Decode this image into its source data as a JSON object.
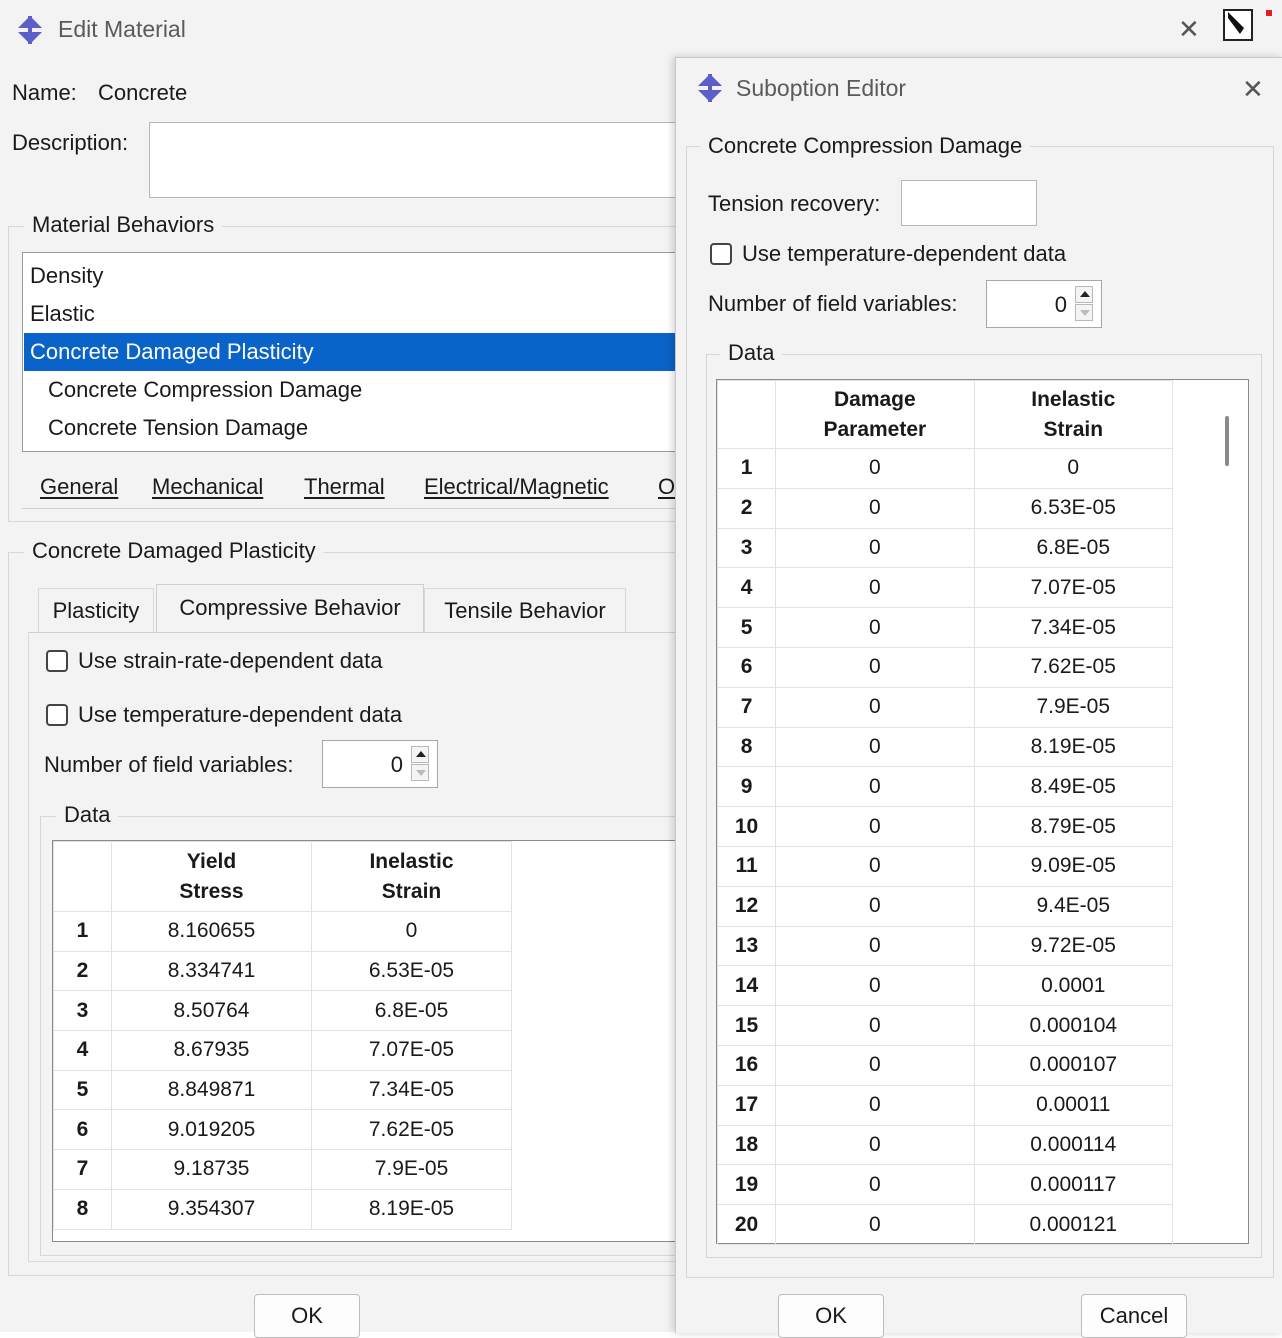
{
  "edit_material": {
    "title": "Edit Material",
    "name_label": "Name:",
    "name_value": "Concrete",
    "description_label": "Description:",
    "description_value": "",
    "material_behaviors": {
      "title": "Material Behaviors",
      "items": [
        {
          "label": "Density",
          "selected": false,
          "sub": false
        },
        {
          "label": "Elastic",
          "selected": false,
          "sub": false
        },
        {
          "label": "Concrete Damaged Plasticity",
          "selected": true,
          "sub": false
        },
        {
          "label": "Concrete Compression Damage",
          "selected": false,
          "sub": true
        },
        {
          "label": "Concrete Tension Damage",
          "selected": false,
          "sub": true
        }
      ]
    },
    "menus": [
      "General",
      "Mechanical",
      "Thermal",
      "Electrical/Magnetic",
      "O"
    ],
    "cdp": {
      "title": "Concrete Damaged Plasticity",
      "tabs": [
        "Plasticity",
        "Compressive Behavior",
        "Tensile Behavior"
      ],
      "active_tab": "Compressive Behavior",
      "strain_rate_label": "Use strain-rate-dependent data",
      "strain_rate_checked": false,
      "temperature_label": "Use temperature-dependent data",
      "temperature_checked": false,
      "field_vars_label": "Number of field variables:",
      "field_vars_value": "0",
      "data_title": "Data",
      "columns": [
        "Yield\nStress",
        "Inelastic\nStrain"
      ],
      "rows": [
        [
          "1",
          "8.160655",
          "0"
        ],
        [
          "2",
          "8.334741",
          "6.53E-05"
        ],
        [
          "3",
          "8.50764",
          "6.8E-05"
        ],
        [
          "4",
          "8.67935",
          "7.07E-05"
        ],
        [
          "5",
          "8.849871",
          "7.34E-05"
        ],
        [
          "6",
          "9.019205",
          "7.62E-05"
        ],
        [
          "7",
          "9.18735",
          "7.9E-05"
        ],
        [
          "8",
          "9.354307",
          "8.19E-05"
        ]
      ]
    },
    "ok_label": "OK"
  },
  "suboption_editor": {
    "title": "Suboption Editor",
    "group_title": "Concrete Compression Damage",
    "tension_recovery_label": "Tension recovery:",
    "tension_recovery_value": "",
    "temperature_label": "Use temperature-dependent data",
    "temperature_checked": false,
    "field_vars_label": "Number of field variables:",
    "field_vars_value": "0",
    "data_title": "Data",
    "columns": [
      "Damage\nParameter",
      "Inelastic\nStrain"
    ],
    "rows": [
      [
        "1",
        "0",
        "0"
      ],
      [
        "2",
        "0",
        "6.53E-05"
      ],
      [
        "3",
        "0",
        "6.8E-05"
      ],
      [
        "4",
        "0",
        "7.07E-05"
      ],
      [
        "5",
        "0",
        "7.34E-05"
      ],
      [
        "6",
        "0",
        "7.62E-05"
      ],
      [
        "7",
        "0",
        "7.9E-05"
      ],
      [
        "8",
        "0",
        "8.19E-05"
      ],
      [
        "9",
        "0",
        "8.49E-05"
      ],
      [
        "10",
        "0",
        "8.79E-05"
      ],
      [
        "11",
        "0",
        "9.09E-05"
      ],
      [
        "12",
        "0",
        "9.4E-05"
      ],
      [
        "13",
        "0",
        "9.72E-05"
      ],
      [
        "14",
        "0",
        "0.0001"
      ],
      [
        "15",
        "0",
        "0.000104"
      ],
      [
        "16",
        "0",
        "0.000107"
      ],
      [
        "17",
        "0",
        "0.00011"
      ],
      [
        "18",
        "0",
        "0.000114"
      ],
      [
        "19",
        "0",
        "0.000117"
      ],
      [
        "20",
        "0",
        "0.000121"
      ]
    ],
    "ok_label": "OK",
    "cancel_label": "Cancel"
  },
  "colors": {
    "selection": "#0a63c9",
    "window_bg": "#f3f3f3",
    "app_icon": "#5b5fc7"
  },
  "icons": [
    "app-icon",
    "close-icon",
    "checkbox",
    "spinner-arrows",
    "scrollbar"
  ]
}
